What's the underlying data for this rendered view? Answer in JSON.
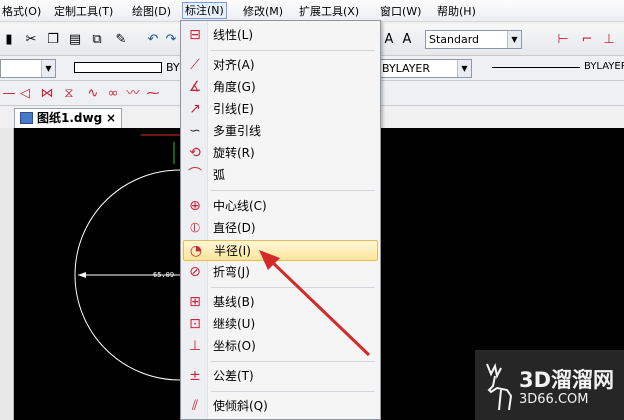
{
  "menubar": {
    "items": [
      {
        "label": "格式(O)"
      },
      {
        "label": "定制工具(T)"
      },
      {
        "label": "绘图(D)"
      },
      {
        "label": "标注(N)"
      },
      {
        "label": "修改(M)"
      },
      {
        "label": "扩展工具(X)"
      },
      {
        "label": "窗口(W)"
      },
      {
        "label": "帮助(H)"
      }
    ]
  },
  "toolbar": {
    "text_style_combo": "Standard",
    "layer_combo_partial": "BY",
    "linetype_combo": "BYLAYER",
    "lineweight_label": "BYLAYER"
  },
  "tab": {
    "label": "图纸1.dwg",
    "close": "×"
  },
  "canvas": {
    "dimension_text": "65.09"
  },
  "dimension_menu": {
    "items": [
      {
        "label": "线性(L)",
        "icon": "linear-dim-icon"
      },
      {
        "label": "对齐(A)",
        "icon": "aligned-dim-icon"
      },
      {
        "label": "角度(G)",
        "icon": "angular-dim-icon"
      },
      {
        "label": "引线(E)",
        "icon": "leader-icon"
      },
      {
        "label": "多重引线",
        "icon": "multileader-icon"
      },
      {
        "label": "旋转(R)",
        "icon": "rotated-dim-icon"
      },
      {
        "label": "弧",
        "icon": "arc-length-icon"
      },
      {
        "label": "中心线(C)",
        "icon": "centerline-icon"
      },
      {
        "label": "直径(D)",
        "icon": "diameter-icon"
      },
      {
        "label": "半径(I)",
        "icon": "radius-icon"
      },
      {
        "label": "折弯(J)",
        "icon": "jogged-icon"
      },
      {
        "label": "基线(B)",
        "icon": "baseline-icon"
      },
      {
        "label": "继续(U)",
        "icon": "continue-icon"
      },
      {
        "label": "坐标(O)",
        "icon": "ordinate-icon"
      },
      {
        "label": "公差(T)",
        "icon": "tolerance-icon"
      },
      {
        "label": "使倾斜(Q)",
        "icon": "oblique-icon"
      }
    ],
    "highlighted": "半径(I)"
  },
  "watermark": {
    "cn": "3D溜溜网",
    "en": "3D66.COM"
  },
  "colors": {
    "highlight": "#fde59a",
    "arrow": "#d42a2a",
    "canvas": "#000000"
  }
}
